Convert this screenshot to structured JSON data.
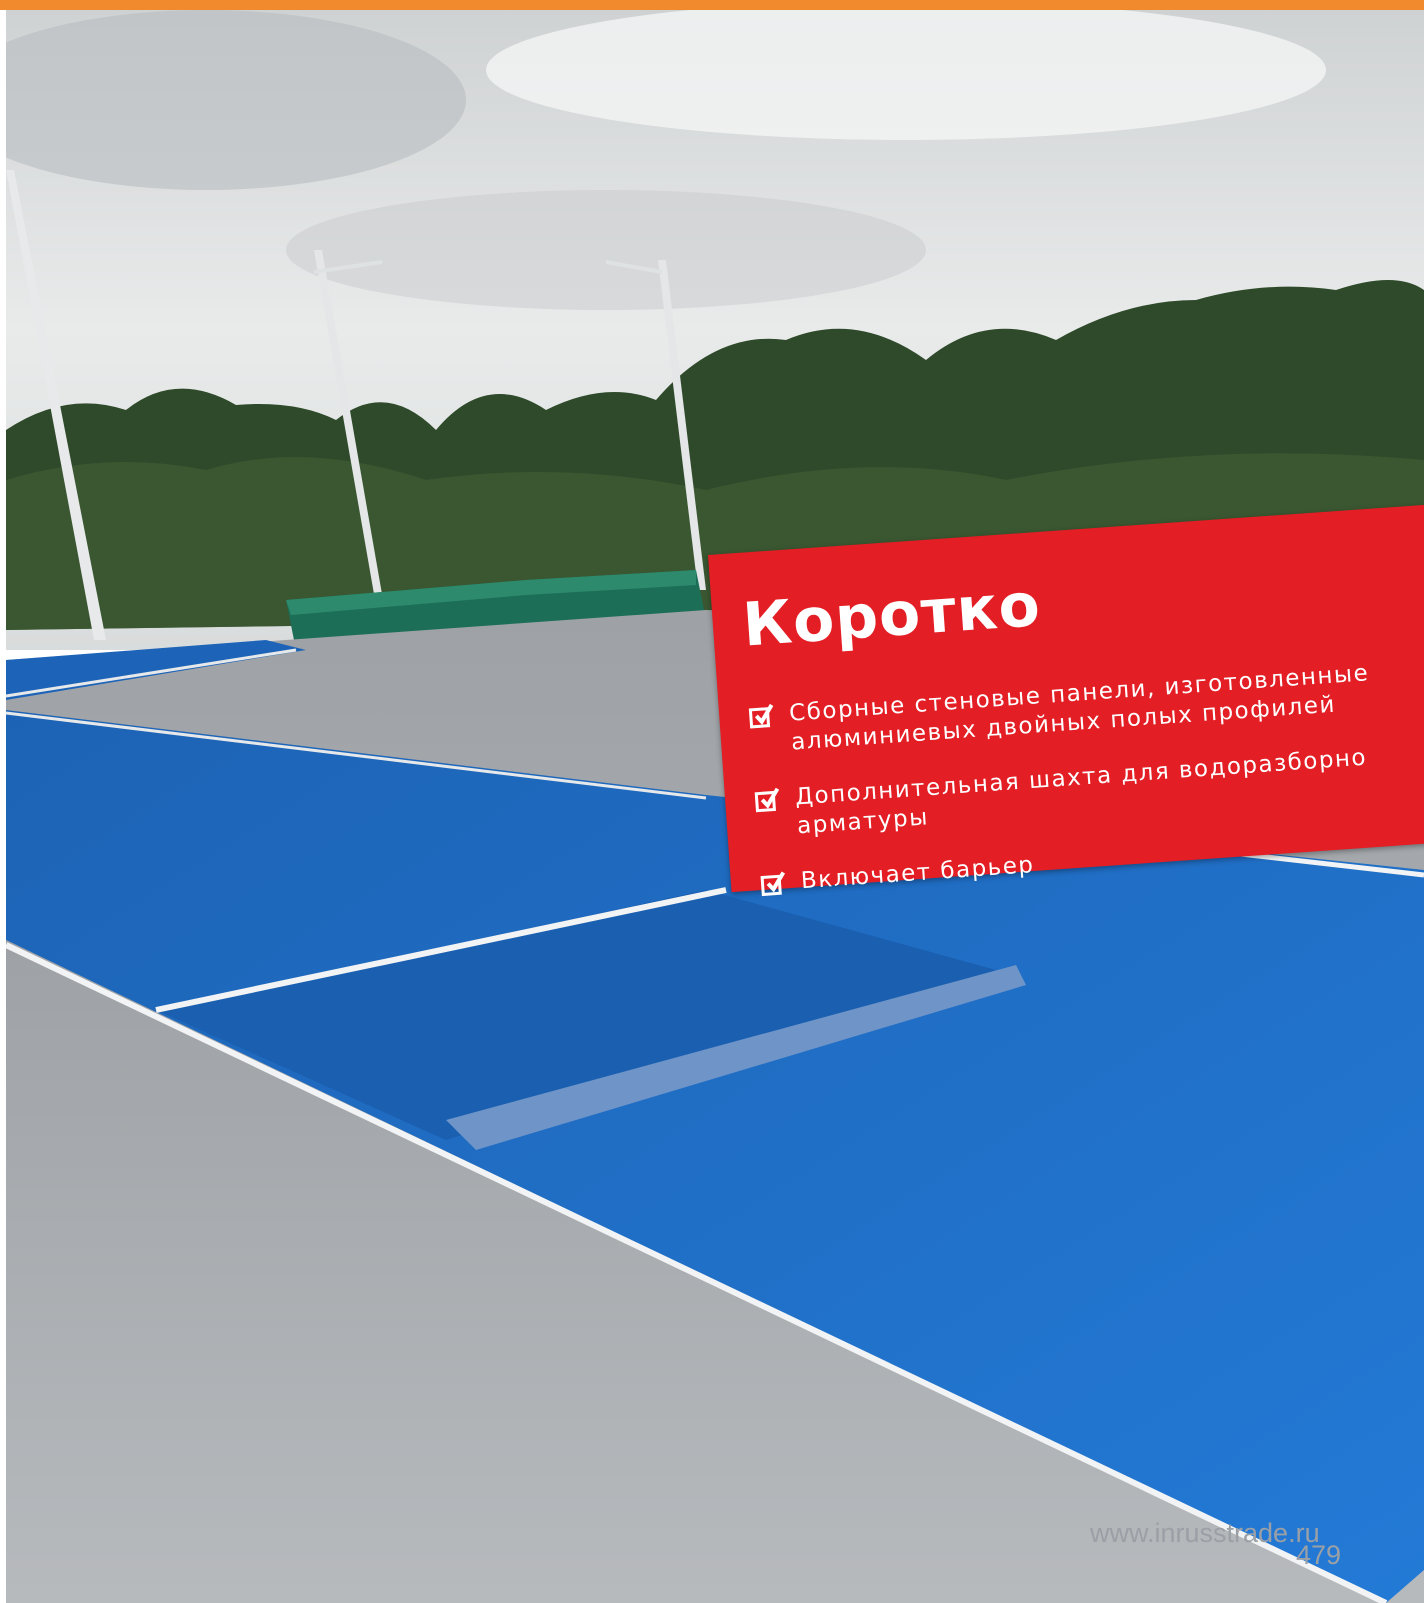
{
  "colors": {
    "top_bar": "#f08a2c",
    "card_red": "#e31e24",
    "track_blue": "#1f6fc6",
    "track_gray": "#a7abae"
  },
  "card": {
    "title": "Коротко",
    "check_icon": "checkbox-checked-icon",
    "bullets": [
      {
        "line1": "Сборные стеновые панели, изготовленные",
        "line2": "алюминиевых двойных полых профилей"
      },
      {
        "line1": "Дополнительная шахта для водоразборно",
        "line2": "арматуры"
      },
      {
        "line1": "Включает барьер",
        "line2": ""
      }
    ]
  },
  "footer": {
    "website": "www.inrusstrade.ru",
    "page_number": "479"
  }
}
